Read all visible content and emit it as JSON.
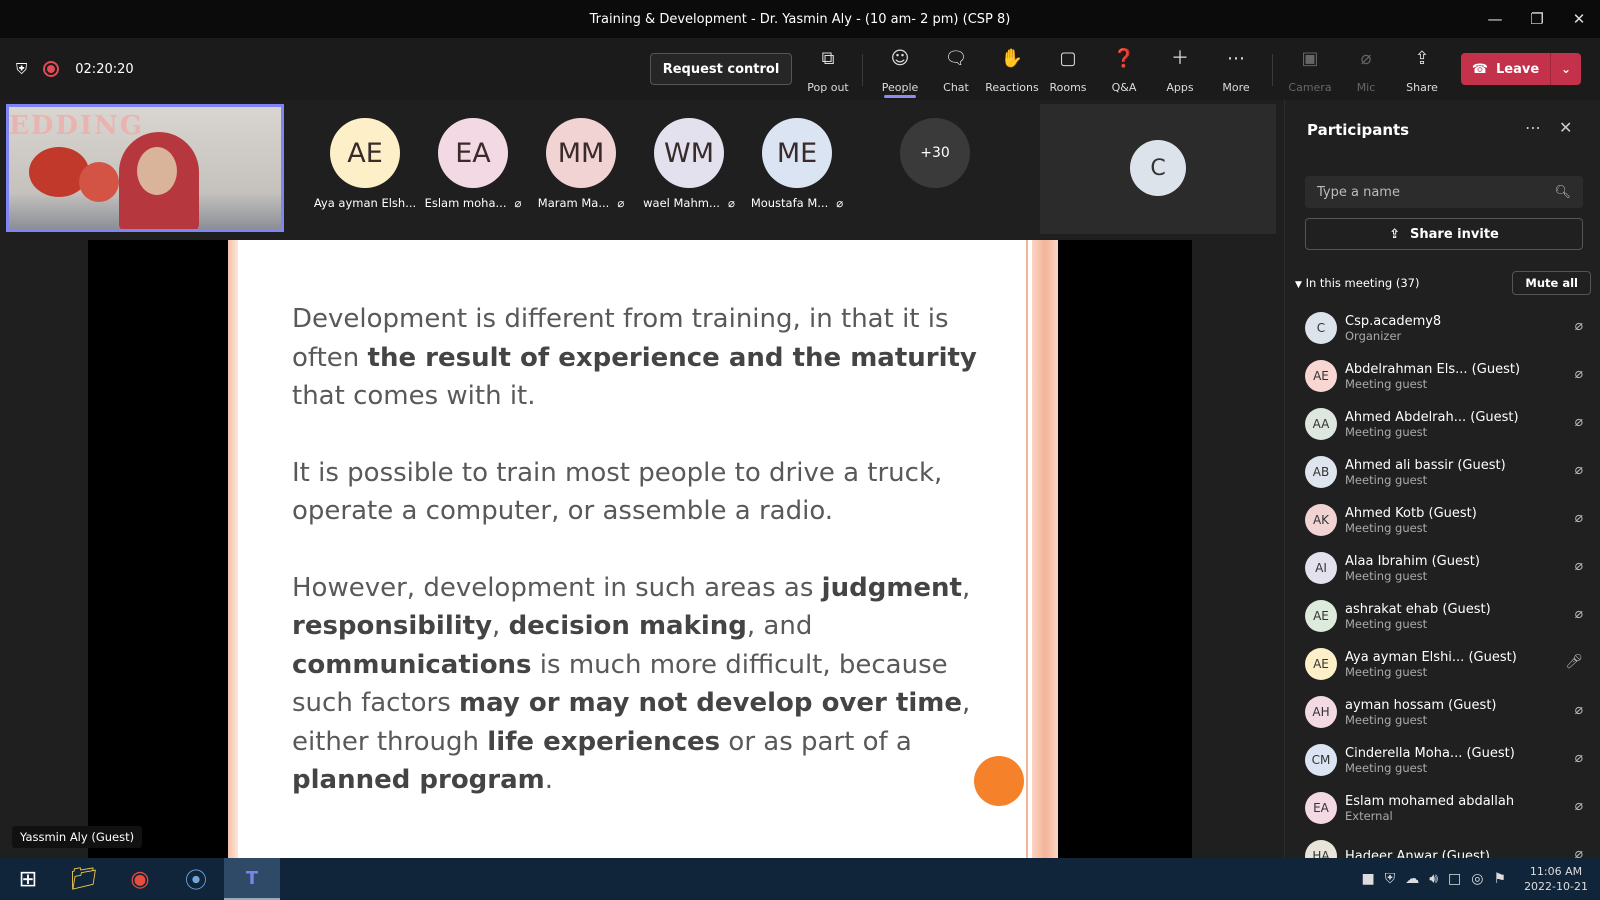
{
  "window": {
    "title": "Training & Development - Dr. Yasmin Aly - (10 am- 2 pm) (CSP 8)"
  },
  "toolbar": {
    "timer": "02:20:20",
    "request_control": "Request control",
    "buttons": [
      {
        "label": "Pop out",
        "icon": "pop-out-icon"
      },
      {
        "label": "People",
        "icon": "people-icon"
      },
      {
        "label": "Chat",
        "icon": "chat-icon"
      },
      {
        "label": "Reactions",
        "icon": "reactions-icon"
      },
      {
        "label": "Rooms",
        "icon": "rooms-icon"
      },
      {
        "label": "Q&A",
        "icon": "qa-icon"
      },
      {
        "label": "Apps",
        "icon": "plus-icon"
      },
      {
        "label": "More",
        "icon": "more-icon"
      },
      {
        "label": "Camera",
        "icon": "camera-off-icon"
      },
      {
        "label": "Mic",
        "icon": "mic-off-icon"
      },
      {
        "label": "Share",
        "icon": "share-icon"
      }
    ],
    "leave": "Leave"
  },
  "stage": {
    "self_banner": "EDDING",
    "avatars": [
      {
        "initials": "AE",
        "name": "Aya ayman Elsh...",
        "color": "#fdf0c8",
        "muted": false
      },
      {
        "initials": "EA",
        "name": "Eslam moha...",
        "color": "#f3d9e3",
        "muted": true
      },
      {
        "initials": "MM",
        "name": "Maram Ma...",
        "color": "#f1d3d3",
        "muted": true
      },
      {
        "initials": "WM",
        "name": "wael Mahm...",
        "color": "#e4e1ef",
        "muted": true
      },
      {
        "initials": "ME",
        "name": "Moustafa M...",
        "color": "#dbe4f2",
        "muted": true
      }
    ],
    "overflow": "+30",
    "tile_c": "C",
    "presenter": "Yassmin Aly (Guest)"
  },
  "slide": {
    "p1": [
      "Development is different from training, in that it is often ",
      "the result of experience and the maturity",
      " that comes with it."
    ],
    "p2": "It is possible to train most people to drive a truck, operate a computer, or assemble a radio.",
    "p3": [
      "However, development in such areas as ",
      "judgment",
      ", ",
      "responsibility",
      ", ",
      "decision making",
      ", and ",
      "communications",
      " is much more difficult, because such factors ",
      "may or may not develop over time",
      ", either through ",
      "life experiences",
      " or as part of a ",
      "planned program",
      "."
    ]
  },
  "panel": {
    "title": "Participants",
    "search_placeholder": "Type a name",
    "share_invite": "Share invite",
    "section": "In this meeting (37)",
    "mute_all": "Mute all",
    "participants": [
      {
        "initials": "C",
        "name": "Csp.academy8",
        "role": "Organizer",
        "color": "#dce3ea",
        "mic": "off"
      },
      {
        "initials": "AE",
        "name": "Abdelrahman Els... (Guest)",
        "role": "Meeting guest",
        "color": "#f8d7d2",
        "mic": "off"
      },
      {
        "initials": "AA",
        "name": "Ahmed Abdelrah... (Guest)",
        "role": "Meeting guest",
        "color": "#dde6df",
        "mic": "off"
      },
      {
        "initials": "AB",
        "name": "Ahmed ali bassir (Guest)",
        "role": "Meeting guest",
        "color": "#dfe5ee",
        "mic": "off"
      },
      {
        "initials": "AK",
        "name": "Ahmed Kotb (Guest)",
        "role": "Meeting guest",
        "color": "#f1d3d3",
        "mic": "off"
      },
      {
        "initials": "AI",
        "name": "Alaa Ibrahim (Guest)",
        "role": "Meeting guest",
        "color": "#e4e1ef",
        "mic": "off"
      },
      {
        "initials": "AE",
        "name": "ashrakat ehab (Guest)",
        "role": "Meeting guest",
        "color": "#dcebdc",
        "mic": "off"
      },
      {
        "initials": "AE",
        "name": "Aya ayman Elshi... (Guest)",
        "role": "Meeting guest",
        "color": "#fdf0c8",
        "mic": "on"
      },
      {
        "initials": "AH",
        "name": "ayman hossam (Guest)",
        "role": "Meeting guest",
        "color": "#f3d9e3",
        "mic": "off"
      },
      {
        "initials": "CM",
        "name": "Cinderella Moha... (Guest)",
        "role": "Meeting guest",
        "color": "#dbe4f2",
        "mic": "off"
      },
      {
        "initials": "EA",
        "name": "Eslam mohamed abdallah",
        "role": "External",
        "color": "#f3d9e3",
        "mic": "off"
      },
      {
        "initials": "HA",
        "name": "Hadeer Anwar (Guest)",
        "role": "",
        "color": "#e8e4da",
        "mic": "off"
      }
    ]
  },
  "taskbar": {
    "time": "11:06 AM",
    "date": "2022-10-21"
  }
}
